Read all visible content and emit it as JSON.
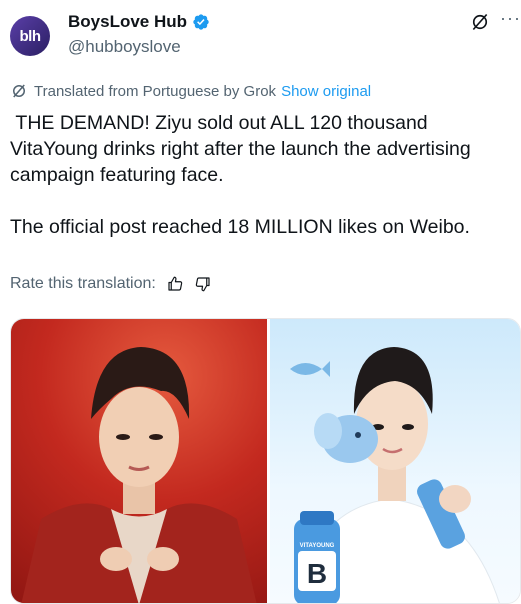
{
  "header": {
    "avatar_text": "blh",
    "display_name": "BoysLove Hub",
    "handle": "@hubboyslove"
  },
  "translation": {
    "label": "Translated from Portuguese by Grok",
    "show_original": "Show original"
  },
  "post": {
    "text": " THE DEMAND! Ziyu sold out ALL 120 thousand VitaYoung drinks right after the launch the advertising campaign featuring face.\n\nThe official post reached 18 MILLION likes on Weibo."
  },
  "rate": {
    "label": "Rate this translation:"
  },
  "media": {
    "bottle_brand": "VITAYOUNG",
    "bottle_letter": "B"
  },
  "colors": {
    "accent": "#1d9bf0",
    "secondary_text": "#536471",
    "left_photo_bg": "#c3291f",
    "right_photo_bg": "#cde9fb"
  }
}
